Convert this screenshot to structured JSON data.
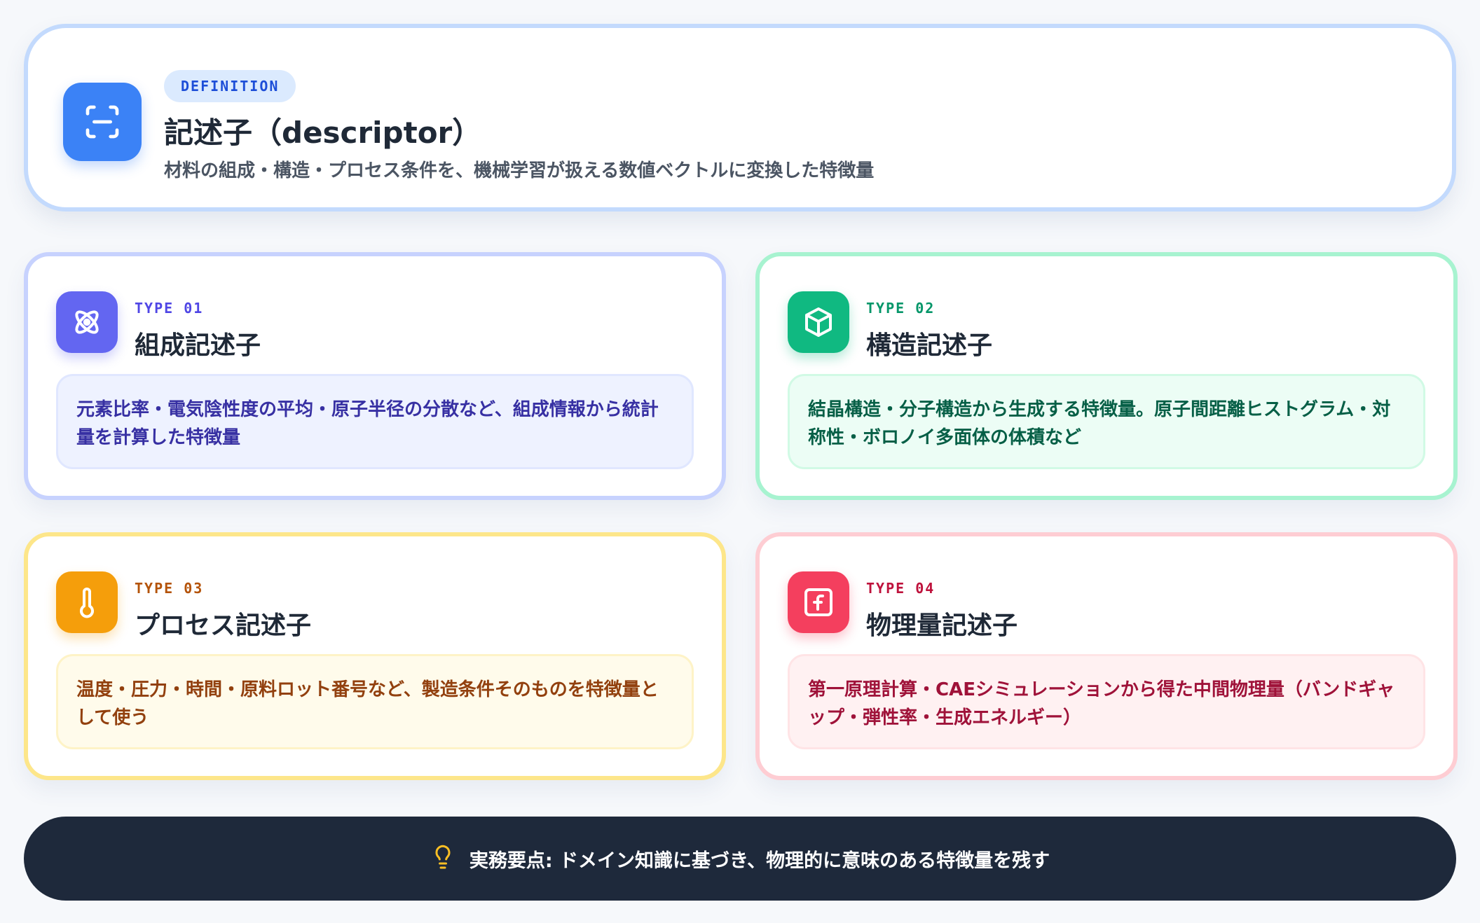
{
  "definition": {
    "badge": "DEFINITION",
    "title": "記述子（descriptor）",
    "description": "材料の組成・構造・プロセス条件を、機械学習が扱える数値ベクトルに変換した特徴量",
    "icon": "scan-icon",
    "accent": "#3b82f6"
  },
  "types": [
    {
      "tag": "TYPE 01",
      "title": "組成記述子",
      "description": "元素比率・電気陰性度の平均・原子半径の分散など、組成情報から統計量を計算した特徴量",
      "icon": "atom-icon",
      "accent": "#6366f1"
    },
    {
      "tag": "TYPE 02",
      "title": "構造記述子",
      "description": "結晶構造・分子構造から生成する特徴量。原子間距離ヒストグラム・対称性・ボロノイ多面体の体積など",
      "icon": "cube-icon",
      "accent": "#10b981"
    },
    {
      "tag": "TYPE 03",
      "title": "プロセス記述子",
      "description": "温度・圧力・時間・原料ロット番号など、製造条件そのものを特徴量として使う",
      "icon": "thermometer-icon",
      "accent": "#f59e0b"
    },
    {
      "tag": "TYPE 04",
      "title": "物理量記述子",
      "description": "第一原理計算・CAEシミュレーションから得た中間物理量（バンドギャップ・弾性率・生成エネルギー）",
      "icon": "function-icon",
      "accent": "#f43f5e"
    }
  ],
  "tip": {
    "text": "実務要点: ドメイン知識に基づき、物理的に意味のある特徴量を残す",
    "icon": "lightbulb-icon",
    "accent": "#fbbf24"
  }
}
